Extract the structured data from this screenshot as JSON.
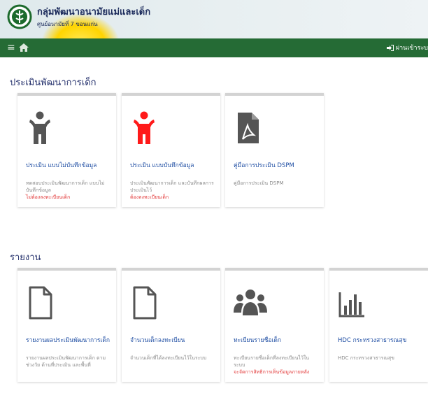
{
  "header": {
    "title": "กลุ่มพัฒนาอนามัยแม่และเด็ก",
    "subtitle": "ศูนย์อนามัยที่ 7 ขอนแก่น",
    "logo_icon": "ministry-logo-icon"
  },
  "nav": {
    "menu_icon": "≡",
    "home_icon": "home-icon",
    "login_label": "ผ่านเข้าระบ"
  },
  "colors": {
    "navbar": "#256b35",
    "title": "#27336e",
    "link": "#1f4ea3",
    "note": "#e23a3a",
    "icon_gray": "#555555",
    "icon_red": "#ff1a1a"
  },
  "section1": {
    "title": "ประเมินพัฒนาการเด็ก",
    "cards": [
      {
        "icon": "child-gray-icon",
        "title": "ประเมิน แบบไม่บันทึกข้อมูล",
        "desc": "ทดสอบประเมินพัฒนาการเด็ก แบบไม่บันทึกข้อมูล",
        "note": "ไม่ต้องลงทะเบียนเด็ก"
      },
      {
        "icon": "child-red-icon",
        "title": "ประเมิน แบบบันทึกข้อมูล",
        "desc": "ประเมินพัฒนาการเด็ก และบันทึกผลการประเมินไว้",
        "note": "ต้องลงทะเบียนเด็ก"
      },
      {
        "icon": "pdf-file-icon",
        "title": "คู่มือการประเมิน DSPM",
        "desc": "คู่มือการประเมิน DSPM",
        "note": ""
      }
    ]
  },
  "section2": {
    "title": "รายงาน",
    "cards": [
      {
        "icon": "file-icon",
        "title": "รายงานผลประเมินพัฒนาการเด็ก",
        "desc": "รายงานผลประเมินพัฒนาการเด็ก ตามช่วงวัย ด้านที่ประเมิน และพื้นที่",
        "note": ""
      },
      {
        "icon": "file-icon",
        "title": "จำนวนเด็กลงทะเบียน",
        "desc": "จำนวนเด็กที่ได้ลงทะเบียนไว้ในระบบ",
        "note": ""
      },
      {
        "icon": "users-icon",
        "title": "ทะเบียนรายชื่อเด็ก",
        "desc": "ทะเบียนรายชื่อเด็กที่ลงทะเบียนไว้ในระบบ",
        "note": "จะจัดการสิทธิการเห็นข้อมูลภายหลัง"
      },
      {
        "icon": "bar-chart-icon",
        "title": "HDC กระทรวงสาธารณสุข",
        "desc": "HDC กระทรวงสาธารณสุข",
        "note": ""
      }
    ]
  }
}
